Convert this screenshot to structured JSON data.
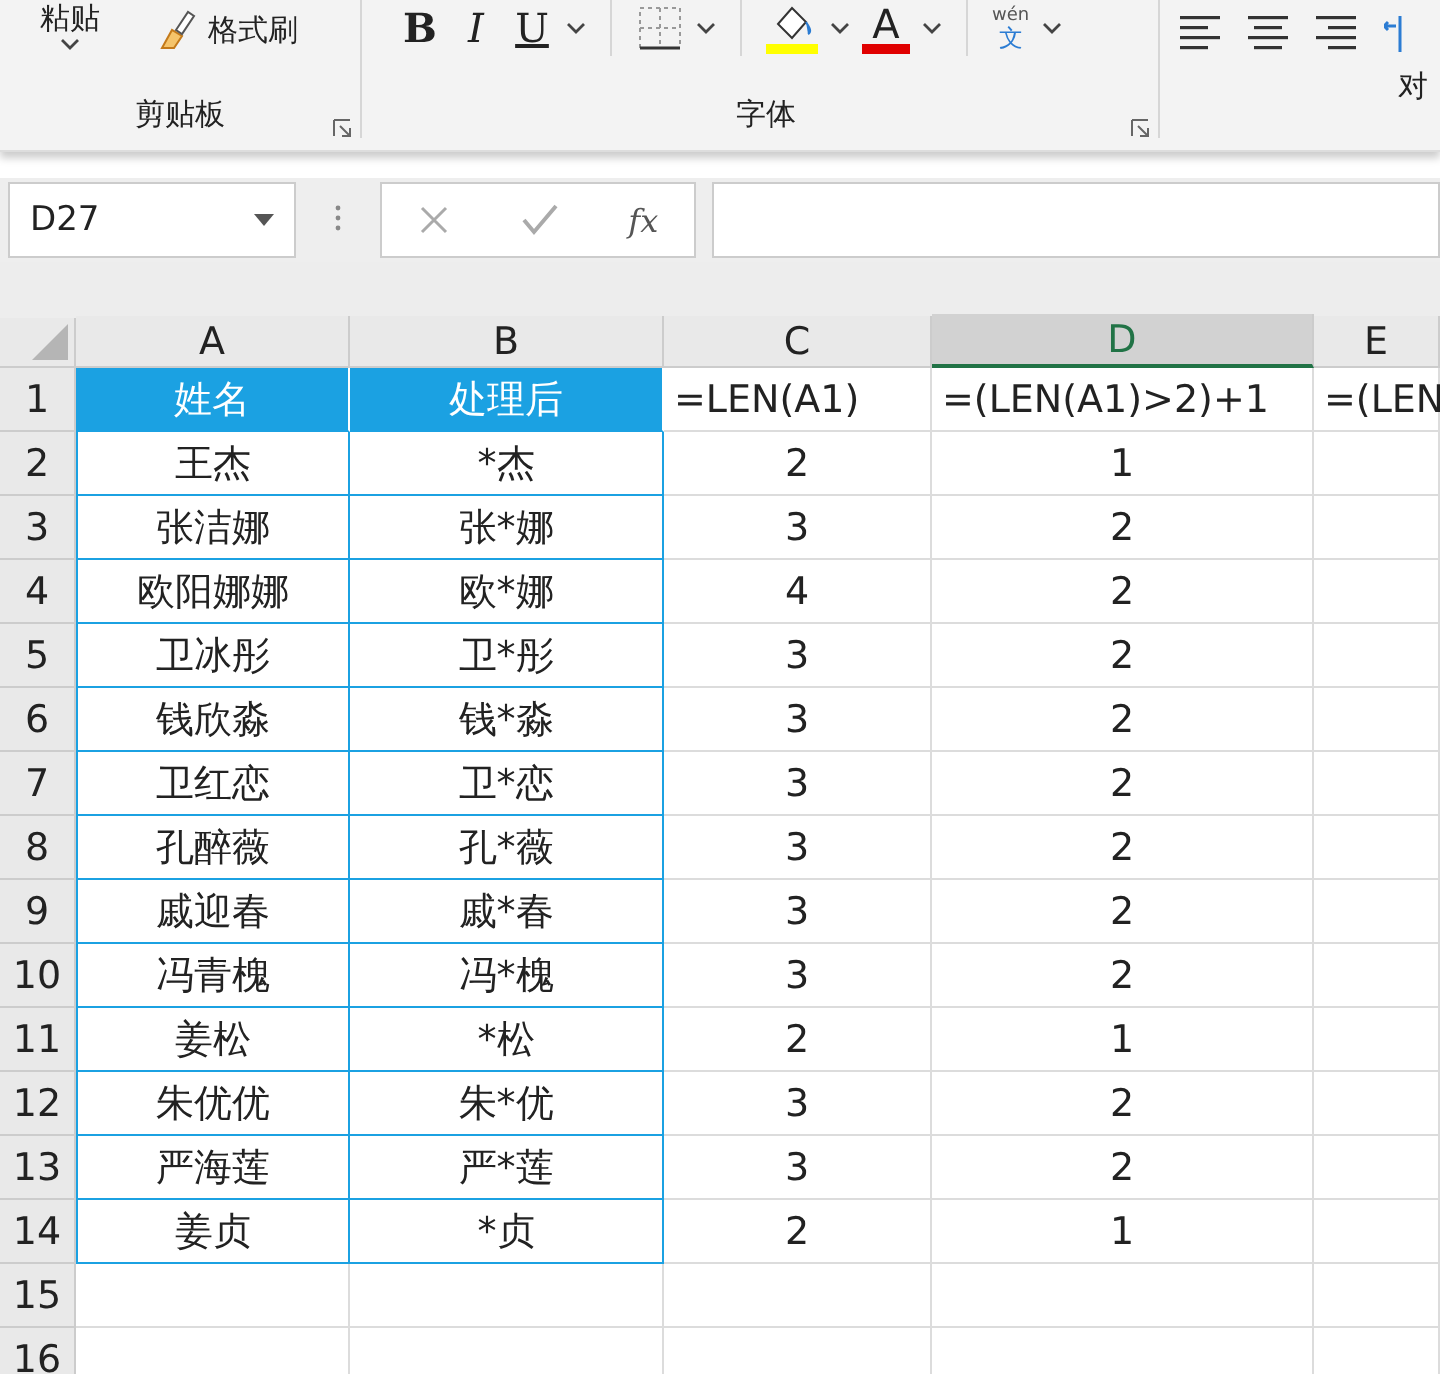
{
  "ribbon": {
    "clipboard": {
      "paste_label": "粘贴",
      "format_painter": "格式刷",
      "group_label": "剪贴板"
    },
    "font": {
      "bold": "B",
      "italic": "I",
      "underline": "U",
      "font_color_letter": "A",
      "phonetic_top": "wén",
      "phonetic_char": "文",
      "group_label": "字体"
    },
    "next_group_label": "对"
  },
  "formula_bar": {
    "name_box": "D27",
    "function_label": "fx"
  },
  "columns": [
    {
      "label": "A",
      "selected": false
    },
    {
      "label": "B",
      "selected": false
    },
    {
      "label": "C",
      "selected": false
    },
    {
      "label": "D",
      "selected": true
    },
    {
      "label": "E",
      "selected": false
    }
  ],
  "rows": [
    {
      "number": "1",
      "kind": "header",
      "cells": [
        "姓名",
        "处理后",
        "=LEN(A1)",
        "=(LEN(A1)>2)+1",
        "=(LEN"
      ]
    },
    {
      "number": "2",
      "kind": "data",
      "cells": [
        "王杰",
        "*杰",
        "2",
        "1"
      ]
    },
    {
      "number": "3",
      "kind": "data",
      "cells": [
        "张洁娜",
        "张*娜",
        "3",
        "2"
      ]
    },
    {
      "number": "4",
      "kind": "data",
      "cells": [
        "欧阳娜娜",
        "欧*娜",
        "4",
        "2"
      ]
    },
    {
      "number": "5",
      "kind": "data",
      "cells": [
        "卫冰彤",
        "卫*彤",
        "3",
        "2"
      ]
    },
    {
      "number": "6",
      "kind": "data",
      "cells": [
        "钱欣淼",
        "钱*淼",
        "3",
        "2"
      ]
    },
    {
      "number": "7",
      "kind": "data",
      "cells": [
        "卫红恋",
        "卫*恋",
        "3",
        "2"
      ]
    },
    {
      "number": "8",
      "kind": "data",
      "cells": [
        "孔醉薇",
        "孔*薇",
        "3",
        "2"
      ]
    },
    {
      "number": "9",
      "kind": "data",
      "cells": [
        "戚迎春",
        "戚*春",
        "3",
        "2"
      ]
    },
    {
      "number": "10",
      "kind": "data",
      "cells": [
        "冯青槐",
        "冯*槐",
        "3",
        "2"
      ]
    },
    {
      "number": "11",
      "kind": "data",
      "cells": [
        "姜松",
        "*松",
        "2",
        "1"
      ]
    },
    {
      "number": "12",
      "kind": "data",
      "cells": [
        "朱优优",
        "朱*优",
        "3",
        "2"
      ]
    },
    {
      "number": "13",
      "kind": "data",
      "cells": [
        "严海莲",
        "严*莲",
        "3",
        "2"
      ]
    },
    {
      "number": "14",
      "kind": "data",
      "cells": [
        "姜贞",
        "*贞",
        "2",
        "1"
      ]
    },
    {
      "number": "15",
      "kind": "empty"
    },
    {
      "number": "16",
      "kind": "empty"
    }
  ]
}
